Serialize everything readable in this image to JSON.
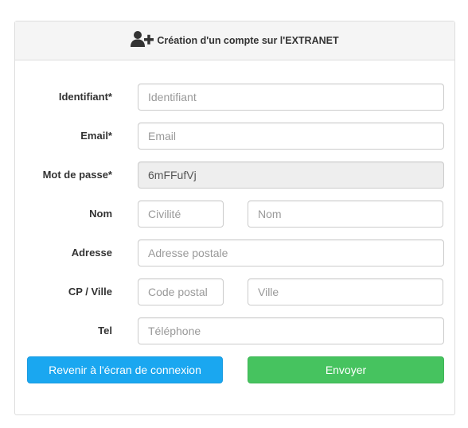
{
  "header": {
    "title": "Création d'un compte sur l'EXTRANET",
    "icon": "user-plus-icon"
  },
  "form": {
    "identifiant": {
      "label": "Identifiant*",
      "value": "",
      "placeholder": "Identifiant"
    },
    "email": {
      "label": "Email*",
      "value": "",
      "placeholder": "Email"
    },
    "password": {
      "label": "Mot de passe*",
      "value": "6mFFufVj",
      "placeholder": ""
    },
    "nom": {
      "label": "Nom",
      "civilite_placeholder": "Civilité",
      "nom_placeholder": "Nom"
    },
    "adresse": {
      "label": "Adresse",
      "placeholder": "Adresse postale"
    },
    "cp_ville": {
      "label": "CP / Ville",
      "cp_placeholder": "Code postal",
      "ville_placeholder": "Ville"
    },
    "tel": {
      "label": "Tel",
      "placeholder": "Téléphone"
    }
  },
  "buttons": {
    "back_label": "Revenir à l'écran de connexion",
    "send_label": "Envoyer"
  },
  "colors": {
    "back_button": "#1aa7f0",
    "send_button": "#46c35f",
    "heading_bg": "#f5f5f5"
  }
}
